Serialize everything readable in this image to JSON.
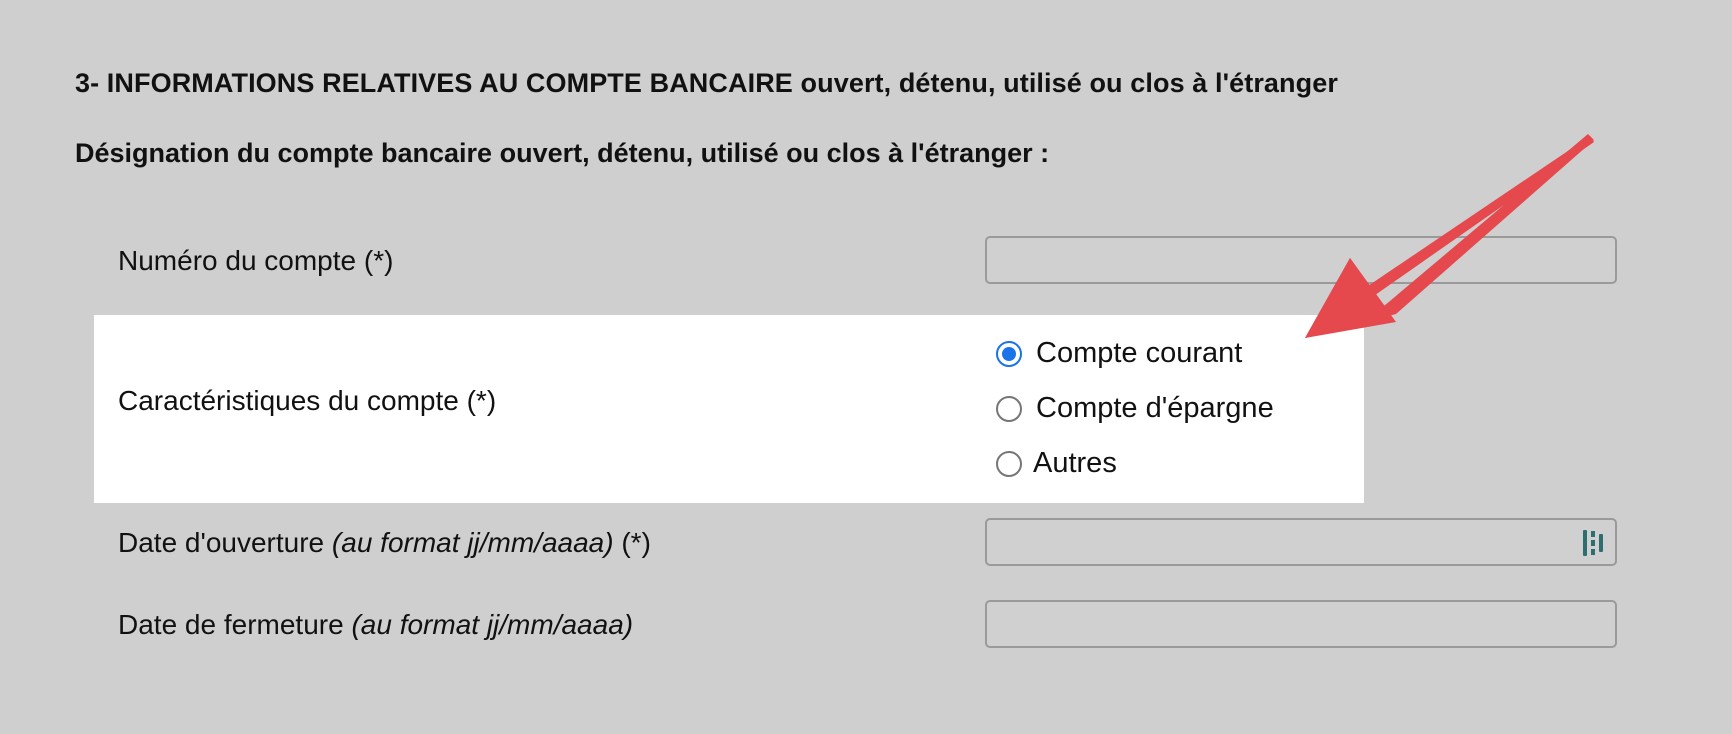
{
  "section": {
    "title_prefix": "3- INFORMATIONS RELATIVES AU COMPTE BANCAIRE",
    "title_suffix": " ouvert, détenu, utilisé ou clos à l'étranger",
    "subtitle": "Désignation du compte bancaire ouvert, détenu, utilisé ou clos à l'étranger :"
  },
  "fields": {
    "account_number": {
      "label": "Numéro du compte (*)",
      "value": ""
    },
    "account_type": {
      "label": "Caractéristiques du compte (*)",
      "options": [
        {
          "label": "Compte courant",
          "checked": true
        },
        {
          "label": "Compte d'épargne",
          "checked": false
        },
        {
          "label": "Autres",
          "checked": false
        }
      ]
    },
    "opening_date": {
      "label": "Date d'ouverture ",
      "hint": "(au format jj/mm/aaaa)",
      "required": " (*)",
      "value": ""
    },
    "closing_date": {
      "label": "Date de fermeture ",
      "hint": "(au format jj/mm/aaaa)",
      "value": ""
    }
  },
  "icons": {
    "calendar": "calendar-picker-icon",
    "annotation_arrow": "red-arrow-icon"
  },
  "colors": {
    "background": "#cfcfcf",
    "radio_checked": "#1a73e8",
    "arrow": "#e5484d",
    "highlight": "#ffffff"
  }
}
